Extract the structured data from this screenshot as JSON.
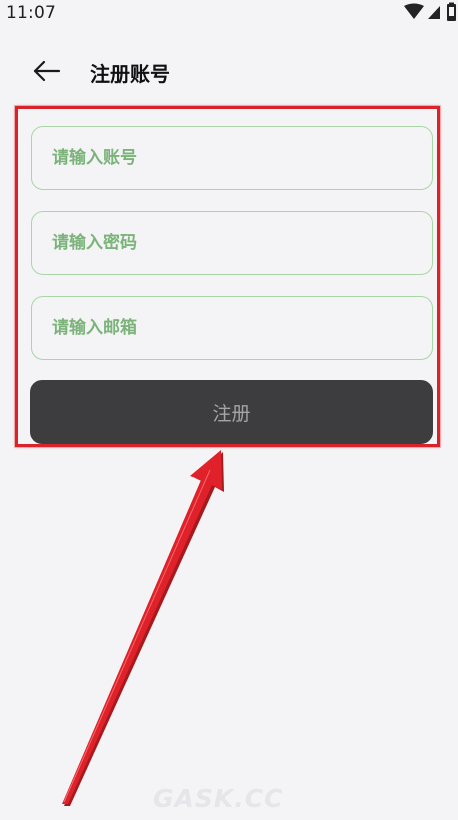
{
  "status_bar": {
    "time": "11:07",
    "icons": [
      "wifi-icon",
      "signal-icon",
      "battery-icon"
    ]
  },
  "header": {
    "back_icon": "arrow-left-icon",
    "title": "注册账号"
  },
  "form": {
    "account": {
      "placeholder": "请输入账号",
      "value": ""
    },
    "password": {
      "placeholder": "请输入密码",
      "value": ""
    },
    "email": {
      "placeholder": "请输入邮箱",
      "value": ""
    },
    "submit_label": "注册"
  },
  "annotation": {
    "highlight_color": "#d8232a",
    "arrow_color": "#d8232a"
  },
  "watermark": "GASK.CC",
  "colors": {
    "background": "#f4f4f6",
    "input_border": "#a9d5a7",
    "placeholder": "#7cb37a",
    "button_bg": "#3d3d3f",
    "button_text": "#a4a4a6"
  }
}
